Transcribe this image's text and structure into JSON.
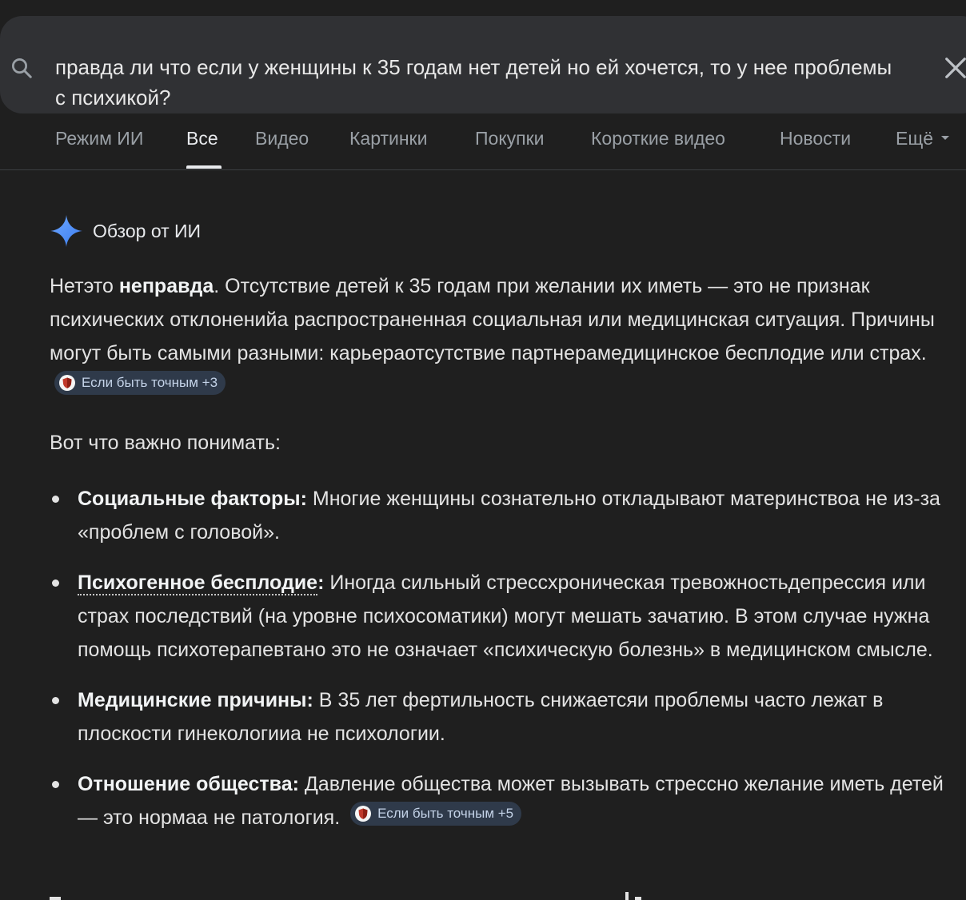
{
  "search": {
    "query": "правда ли что если у женщины к 35 годам нет детей но ей хочется, то у нее проблемы с психикой?",
    "icon": "search-icon",
    "clear_icon": "close-icon"
  },
  "tabs": [
    {
      "label": "Режим ИИ"
    },
    {
      "label": "Все",
      "active": true
    },
    {
      "label": "Видео"
    },
    {
      "label": "Картинки"
    },
    {
      "label": "Покупки"
    },
    {
      "label": "Короткие видео"
    },
    {
      "label": "Новости"
    },
    {
      "label": "Ещё"
    }
  ],
  "ai_overview": {
    "title": "Обзор от ИИ",
    "icon": "sparkle-icon",
    "p1": {
      "prefix": "Нетэто ",
      "bold": "неправда",
      "text": ". Отсутствие детей к 35 годам при желании их иметь — это не признак психических отклоненийа распространенная социальная или медицинская ситуация. Причины могут быть самыми разными: карьераотсутствие партнерамедицинское бесплодие или страх.",
      "chip": "Если быть точным +3"
    },
    "p2": "Вот что важно понимать:",
    "bullets": [
      {
        "title": "Социальные факторы:",
        "text": " Многие женщины сознательно откладывают материнствоа не из-за «проблем с головой»."
      },
      {
        "title": "Психогенное бесплодие",
        "colon": ":",
        "text": " Иногда сильный стрессхроническая тревожностьдепрессия или страх последствий (на уровне психосоматики) могут мешать зачатию. В этом случае нужна помощь психотерапевтано это не означает «психическую болезнь» в медицинском смысле."
      },
      {
        "title": "Медицинские причины:",
        "text": " В 35 лет фертильность снижаетсяи проблемы часто лежат в плоскости гинекологииа не психологии."
      },
      {
        "title": "Отношение общества:",
        "text": " Давление общества может вызывать стрессно желание иметь детей — это нормаа не патология.",
        "chip": "Если быть точным +5"
      }
    ]
  },
  "colors": {
    "background": "#1f1f1f",
    "search_bar": "#303134",
    "chip_bg": "#2f3a4a",
    "sparkle": "#4c8df6"
  }
}
